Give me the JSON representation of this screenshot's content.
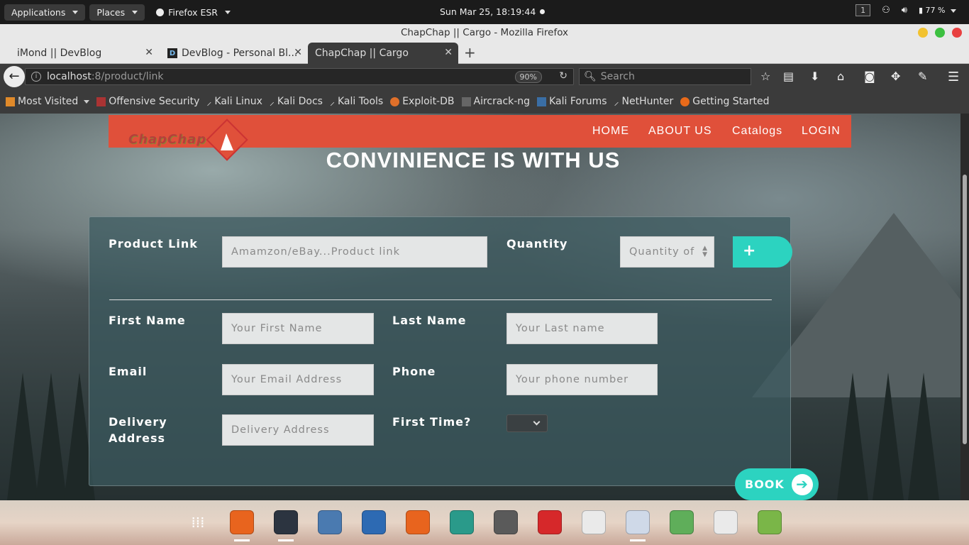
{
  "topbar": {
    "applications": "Applications",
    "places": "Places",
    "firefox": "Firefox ESR",
    "clock": "Sun Mar 25, 18:19:44",
    "workspace": "1",
    "battery": "77 %"
  },
  "window": {
    "title": "ChapChap || Cargo - Mozilla Firefox"
  },
  "tabs": [
    {
      "label": "iMond || DevBlog"
    },
    {
      "label": "DevBlog - Personal Bl..."
    },
    {
      "label": "ChapChap || Cargo"
    }
  ],
  "navbar": {
    "url_host": "localhost",
    "url_path": ":8/product/link",
    "zoom": "90%",
    "search_placeholder": "Search"
  },
  "bookmarks": [
    {
      "label": "Most Visited",
      "color": "#e08a2a"
    },
    {
      "label": "Offensive Security",
      "color": "#a33"
    },
    {
      "label": "Kali Linux",
      "color": "#222"
    },
    {
      "label": "Kali Docs",
      "color": "#222"
    },
    {
      "label": "Kali Tools",
      "color": "#222"
    },
    {
      "label": "Exploit-DB",
      "color": "#e0702a"
    },
    {
      "label": "Aircrack-ng",
      "color": "#666"
    },
    {
      "label": "Kali Forums",
      "color": "#3a6ea5"
    },
    {
      "label": "NetHunter",
      "color": "#222"
    },
    {
      "label": "Getting Started",
      "color": "#e86a1a"
    }
  ],
  "site": {
    "logo_text": "ChapChap",
    "nav": {
      "home": "HOME",
      "about": "ABOUT US",
      "catalogs": "Catalogs",
      "login": "LOGIN"
    },
    "hero": "CONVINIENCE IS WITH US",
    "accent": "#e0503a",
    "button_color": "#2cd3c0"
  },
  "form": {
    "product_link_label": "Product Link",
    "product_link_placeholder": "Amamzon/eBay...Product link",
    "quantity_label": "Quantity",
    "quantity_placeholder": "Quantity of",
    "add_label": "+",
    "first_name_label": "First Name",
    "first_name_placeholder": "Your First Name",
    "last_name_label": "Last Name",
    "last_name_placeholder": "Your Last name",
    "email_label": "Email",
    "email_placeholder": "Your Email Address",
    "phone_label": "Phone",
    "phone_placeholder": "Your phone number",
    "delivery_label_1": "Delivery",
    "delivery_label_2": "Address",
    "delivery_placeholder": "Delivery Address",
    "first_time_label": "First Time?",
    "book_label": "BOOK"
  },
  "dock_icons": [
    {
      "name": "app-grid-icon",
      "color": "#ffffff00"
    },
    {
      "name": "firefox-icon",
      "color": "#e8641e"
    },
    {
      "name": "terminal-icon",
      "color": "#2c3440"
    },
    {
      "name": "files-icon",
      "color": "#4a7ab0"
    },
    {
      "name": "metasploit-icon",
      "color": "#2d6ab3"
    },
    {
      "name": "burpsuite-icon",
      "color": "#e8641e"
    },
    {
      "name": "armitage-icon",
      "color": "#2a9a8a"
    },
    {
      "name": "maltego-icon",
      "color": "#5a5a5a"
    },
    {
      "name": "flashpoint-icon",
      "color": "#d6282a"
    },
    {
      "name": "editor-icon",
      "color": "#eaeaea"
    },
    {
      "name": "atom-icon",
      "color": "#cfd9e8"
    },
    {
      "name": "image-viewer-icon",
      "color": "#5fae5a"
    },
    {
      "name": "tasks-icon",
      "color": "#eaeaea"
    },
    {
      "name": "android-studio-icon",
      "color": "#7ab648"
    }
  ]
}
